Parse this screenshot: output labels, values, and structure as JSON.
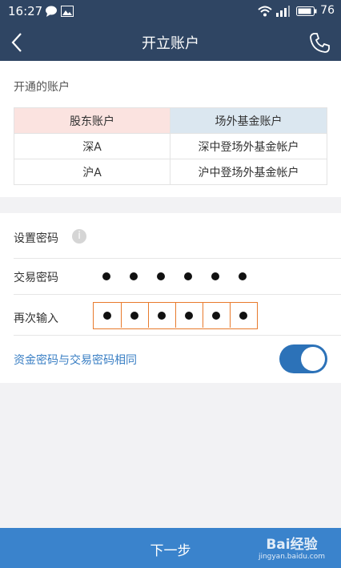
{
  "status_bar": {
    "time": "16:27",
    "battery": "76"
  },
  "nav": {
    "title": "开立账户"
  },
  "accounts": {
    "section_label": "开通的账户",
    "headers": [
      "股东账户",
      "场外基金账户"
    ],
    "rows": [
      [
        "深A",
        "深中登场外基金帐户"
      ],
      [
        "沪A",
        "沪中登场外基金帐户"
      ]
    ]
  },
  "password": {
    "section_label": "设置密码",
    "trade_label": "交易密码",
    "confirm_label": "再次输入",
    "same_toggle_label": "资金密码与交易密码相同",
    "same_toggle_on": true,
    "digit_count": 6
  },
  "footer": {
    "next_label": "下一步"
  },
  "watermark": {
    "line1": "Bai经验",
    "line2": "jingyan.baidu.com"
  },
  "colors": {
    "nav_bg": "#2f4563",
    "footer_bg": "#3a83cc",
    "accent": "#2c72b8",
    "pw_border": "#e87a2c"
  }
}
